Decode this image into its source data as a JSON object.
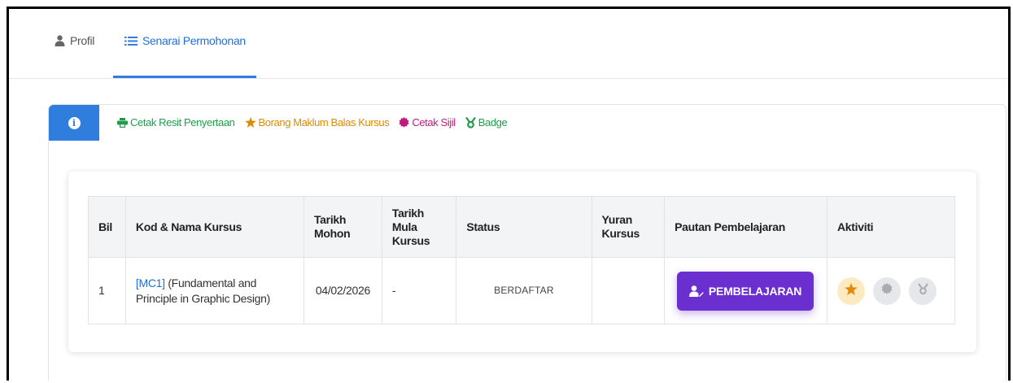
{
  "tabs": {
    "profil": "Profil",
    "senarai": "Senarai Permohonan"
  },
  "links": {
    "cetak_resit": "Cetak Resit Penyertaan",
    "borang": "Borang Maklum Balas Kursus",
    "cetak_sijil": "Cetak Sijil",
    "badge": "Badge"
  },
  "table": {
    "headers": {
      "bil": "Bil",
      "kod_nama": "Kod & Nama Kursus",
      "tarikh_mohon": "Tarikh Mohon",
      "tarikh_mula": "Tarikh Mula Kursus",
      "status": "Status",
      "yuran": "Yuran Kursus",
      "pautan": "Pautan Pembelajaran",
      "aktiviti": "Aktiviti"
    },
    "rows": [
      {
        "bil": "1",
        "kod": "[MC1]",
        "nama": " (Fundamental and Principle in Graphic Design)",
        "tarikh_mohon": "04/02/2026",
        "tarikh_mula": "-",
        "status": "BERDAFTAR",
        "yuran": "",
        "button": "PEMBELAJARAN"
      }
    ]
  },
  "icons": [
    "user-icon",
    "list-icon",
    "info-icon",
    "printer-icon",
    "star-icon",
    "certificate-icon",
    "medal-icon",
    "learner-icon"
  ],
  "colors": {
    "primary": "#2f7ddd",
    "button": "#6b2fd0",
    "green": "#1f9d4b",
    "orange": "#dd8b00",
    "pink": "#c2187e"
  }
}
